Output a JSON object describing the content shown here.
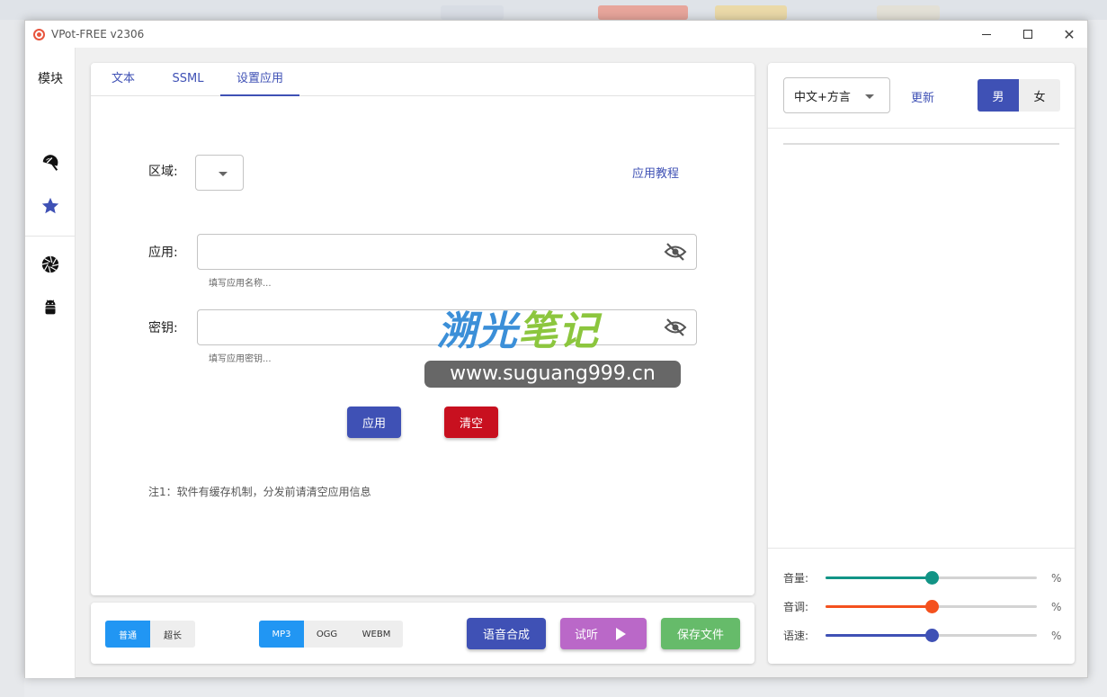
{
  "window": {
    "title": "VPot-FREE v2306"
  },
  "leftnav": {
    "title": "模块",
    "icons": [
      "beach-umbrella-icon",
      "star-icon",
      "camera-aperture-icon",
      "android-icon"
    ]
  },
  "tabs": [
    {
      "label": "文本",
      "active": false
    },
    {
      "label": "SSML",
      "active": false
    },
    {
      "label": "设置应用",
      "active": true
    }
  ],
  "settings": {
    "region_label": "区域:",
    "tutorial_link": "应用教程",
    "app_label": "应用:",
    "app_value": "",
    "app_hint": "填写应用名称...",
    "secret_label": "密钥:",
    "secret_value": "",
    "secret_hint": "填写应用密钥...",
    "apply_button": "应用",
    "clear_button": "清空",
    "note": "注1：软件有缓存机制，分发前请清空应用信息"
  },
  "watermark": {
    "part1": "溯光",
    "part2": "笔记",
    "url": "www.suguang999.cn"
  },
  "bottom": {
    "length_options": [
      {
        "label": "普通",
        "selected": true
      },
      {
        "label": "超长",
        "selected": false
      }
    ],
    "format_options": [
      {
        "label": "MP3",
        "selected": true
      },
      {
        "label": "OGG",
        "selected": false
      },
      {
        "label": "WEBM",
        "selected": false
      }
    ],
    "synthesize_button": "语音合成",
    "preview_button": "试听",
    "save_button": "保存文件"
  },
  "right_panel": {
    "language_select": "中文+方言",
    "update_link": "更新",
    "gender_male": "男",
    "gender_female": "女",
    "gender_selected": "男",
    "sliders": [
      {
        "label": "音量:",
        "value": 50,
        "unit": "%",
        "color": "#129486"
      },
      {
        "label": "音调:",
        "value": 50,
        "unit": "%",
        "color": "#f4511e"
      },
      {
        "label": "语速:",
        "value": 50,
        "unit": "%",
        "color": "#3f51b5"
      }
    ]
  },
  "colors": {
    "primary": "#3f51b5",
    "danger": "#c8101f",
    "synth": "#3f51b5",
    "preview": "#ba68c8",
    "save": "#66bb6a",
    "segment_on": "#2196f3"
  }
}
